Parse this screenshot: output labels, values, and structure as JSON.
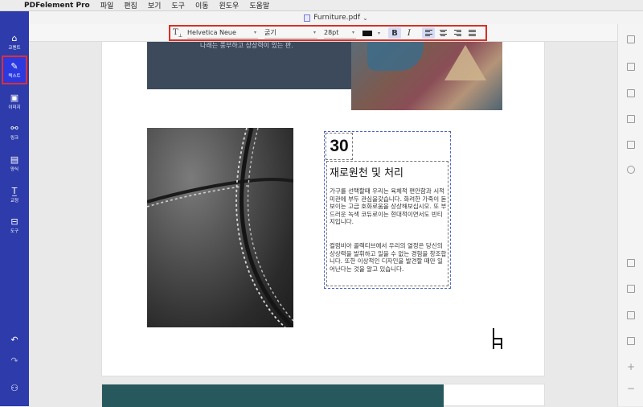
{
  "menubar": {
    "items": [
      "PDFelement Pro",
      "파일",
      "편집",
      "보기",
      "도구",
      "이동",
      "윈도우",
      "도움말"
    ]
  },
  "titlebar": {
    "filename": "Furniture.pdf"
  },
  "toolbar": {
    "font_family": "Helvetica Neue",
    "font_style": "굵기",
    "font_size": "28pt",
    "color": "#111111",
    "bold_label": "B",
    "italic_label": "I",
    "text_tool_label": "T"
  },
  "sidebar": {
    "items": [
      {
        "label": "코멘트",
        "icon": "comment-icon"
      },
      {
        "label": "텍스트",
        "icon": "pen-icon",
        "active": true
      },
      {
        "label": "이미지",
        "icon": "image-icon"
      },
      {
        "label": "링크",
        "icon": "link-icon"
      },
      {
        "label": "양식",
        "icon": "form-icon"
      },
      {
        "label": "교정",
        "icon": "redact-icon"
      },
      {
        "label": "도구",
        "icon": "toolbox-icon"
      }
    ],
    "accent": "#2d3bab",
    "active_border": "#e0302a"
  },
  "document": {
    "top_text": "나래는 풍부하고 상상력이 있는 판.",
    "number": "30",
    "heading": "재로원천 및 처리",
    "para1": "가구를 선택할때 우리는 육체적 편안함과 시적 미관에 부두 관심을갖습니다. 화려한 가죽이 돋보이는 고급 호화로움을 상상해보십시오. 또 부드러운 녹색 코듀로이는 현대적이면서도 빈티지입니다.",
    "para2": "컬럼비아 콜렉티브에서 우리의 열정은 당신의 상상력을 발휘하고 일을 수 없는 경험을 창조합니다. 또한 이상적인 디자인을 발견할 때만 일어난다는 것을 알고 있습니다."
  }
}
